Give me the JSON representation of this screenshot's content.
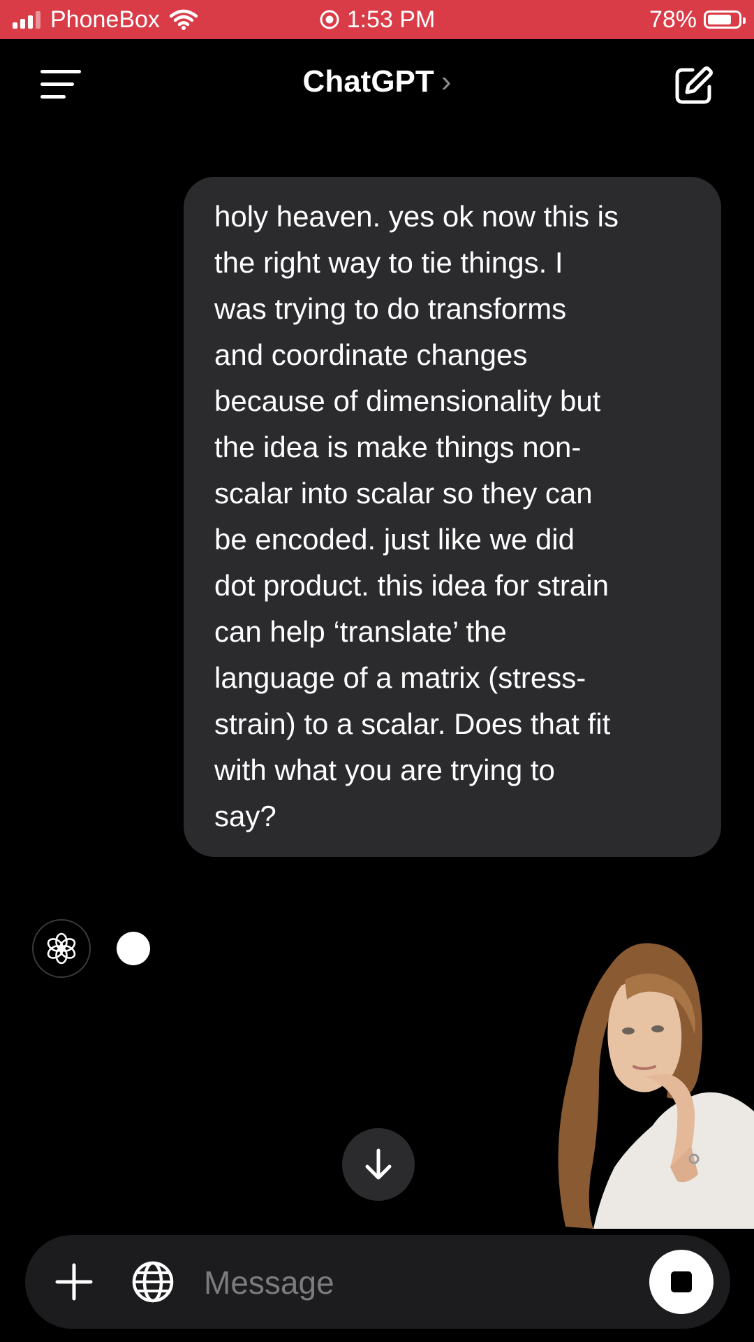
{
  "status_bar": {
    "carrier": "PhoneBox",
    "time": "1:53 PM",
    "battery": "78%",
    "battery_level": 0.78,
    "background_color": "#d93b47",
    "icons": [
      "signal-icon",
      "wifi-icon",
      "location-icon",
      "battery-icon"
    ]
  },
  "nav": {
    "title": "ChatGPT",
    "chevron": "›",
    "icons": [
      "menu-icon",
      "new-chat-icon"
    ]
  },
  "messages": [
    {
      "role": "user",
      "lines": [
        "holy heaven. yes ok now this is",
        "the right way to tie things. I",
        "was trying to do transforms",
        "and coordinate changes",
        "because of dimensionality but",
        "the idea is make things non-",
        "scalar into scalar so they can",
        "be encoded. just like we did",
        "dot product. this idea for strain",
        "can help ‘translate’ the",
        "language of a matrix (stress-",
        "strain) to a scalar. Does that fit",
        "with what you are trying to",
        "say?"
      ]
    },
    {
      "role": "assistant",
      "status": "typing",
      "icons": [
        "openai-logo-icon"
      ]
    }
  ],
  "composer": {
    "placeholder": "Message",
    "icons": [
      "plus-icon",
      "globe-icon",
      "stop-icon"
    ]
  },
  "scroll_button": {
    "icon": "arrow-down-icon"
  },
  "colors": {
    "background": "#000000",
    "bubble": "#2b2b2e",
    "composer": "#1c1c1e",
    "placeholder": "#7c7c80"
  }
}
